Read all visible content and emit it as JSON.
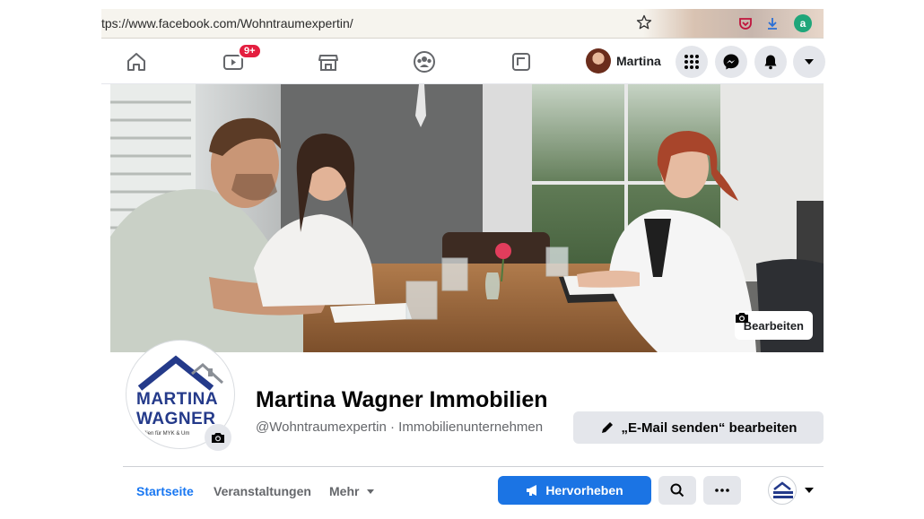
{
  "browser": {
    "url": "tps://www.facebook.com/Wohntraumexpertin/",
    "icons": [
      "star-icon",
      "pocket-icon",
      "download-icon",
      "extension-a-icon"
    ]
  },
  "fb_nav": {
    "icons": [
      "home-icon",
      "watch-icon",
      "marketplace-icon",
      "groups-icon",
      "gaming-icon"
    ],
    "watch_badge": "9+",
    "profile_name": "Martina",
    "right_icons": [
      "menu-grid-icon",
      "messenger-icon",
      "notifications-bell-icon",
      "account-caret-icon"
    ]
  },
  "cover": {
    "edit_label": "Bearbeiten"
  },
  "profile": {
    "logo_line1": "MARTINA",
    "logo_line2": "WAGNER",
    "logo_tagline": "obilien für MYK & Um",
    "name": "Martina Wagner Immobilien",
    "handle": "@Wohntraumexpertin · Immobilienunternehmen",
    "email_button": "„E-Mail senden“ bearbeiten"
  },
  "page_tabs": {
    "items": [
      "Startseite",
      "Veranstaltungen",
      "Mehr"
    ],
    "active": "Startseite",
    "promote_label": "Hervorheben"
  },
  "colors": {
    "accent": "#1877f2",
    "promote": "#1b74e4",
    "badge": "#e41e3f",
    "logo_blue": "#243a8a"
  }
}
